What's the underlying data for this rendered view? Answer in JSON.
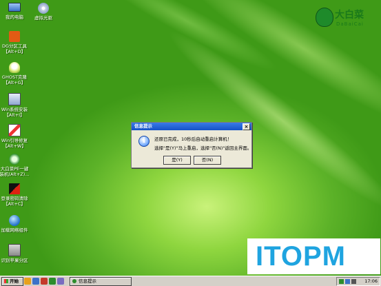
{
  "desktop_icons": [
    {
      "label": "我的电脑",
      "icon": "computer-icon"
    },
    {
      "label": "虚拟光驱",
      "icon": "virtual-drive-icon"
    },
    {
      "label": "DG分区工具\n【Alt+D】",
      "icon": "partition-tool-icon"
    },
    {
      "label": "GHOST克隆\n【Alt+G】",
      "icon": "ghost-icon"
    },
    {
      "label": "Win系统安装\n【Alt+I】",
      "icon": "windows-install-icon"
    },
    {
      "label": "Win引导修复\n【Alt+W】",
      "icon": "boot-repair-icon"
    },
    {
      "label": "大白菜PE一键\n装机(Alt+Z)...",
      "icon": "dabaicai-install-icon"
    },
    {
      "label": "登录密码清除\n【Alt+C】",
      "icon": "password-clear-icon"
    },
    {
      "label": "加载网络组件",
      "icon": "network-icon"
    },
    {
      "label": "识别苹果分区",
      "icon": "apple-partition-icon"
    }
  ],
  "logo": {
    "name": "大白菜",
    "sub": "DaBaiCai"
  },
  "dialog": {
    "title": "信息提示",
    "close": "×",
    "message_line1": "还原已完成，10秒后自动重启计算机！",
    "message_line2": "选择\"是(Y)\"马上重启，选择\"否(N)\"返回主界面。",
    "yes_label": "是(Y)",
    "no_label": "否(N)"
  },
  "watermark": {
    "text": "ITOPM"
  },
  "taskbar": {
    "start_label": "开始",
    "window_button_label": "信息提示",
    "clock": "17:06"
  },
  "colors": {
    "accent": "#1552c8",
    "watermark": "#1fa4e0",
    "logo": "#1a7a1a"
  }
}
